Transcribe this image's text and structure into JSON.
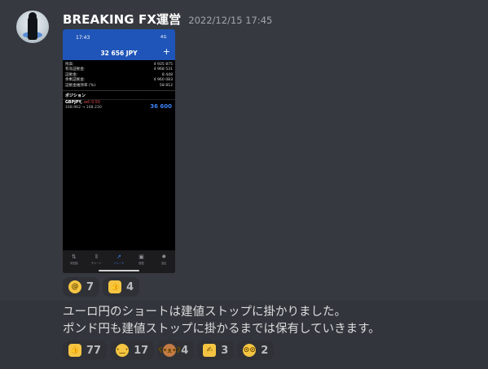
{
  "message": {
    "author": "BREAKING FX運営",
    "timestamp": "2022/12/15 17:45",
    "lines": [
      "ユーロ円のショートは建値ストップに掛かりました。",
      "ポンド円も建値ストップに掛かるまでは保有していきます。"
    ]
  },
  "attachment": {
    "status_time": "17:43",
    "status_right": "4G",
    "title": "32 656 JPY",
    "plus_label": "+",
    "rows": [
      {
        "label": "残高:",
        "value": "4 935 875"
      },
      {
        "label": "有効証拠金:",
        "value": "4 968 531"
      },
      {
        "label": "証拠金:",
        "value": "8 448"
      },
      {
        "label": "余剰証拠金:",
        "value": "4 960 083"
      },
      {
        "label": "証拠金維持率 (%):",
        "value": "58 812"
      }
    ],
    "section_label": "ポジション",
    "position": {
      "symbol": "GBPJPY,",
      "side": "sell 0.50",
      "prices": "168.962 → 168.230",
      "profit": "36 600"
    },
    "nav": [
      {
        "icon": "quotes-icon",
        "label": "気配値"
      },
      {
        "icon": "chart-icon",
        "label": "チャート"
      },
      {
        "icon": "trade-icon",
        "label": "トレード"
      },
      {
        "icon": "history-icon",
        "label": "履歴"
      },
      {
        "icon": "settings-icon",
        "label": "設定"
      }
    ]
  },
  "reactions_top": [
    {
      "emoji": "dizzy-face-emoji",
      "color": "#f5c542",
      "count": "7"
    },
    {
      "emoji": "thumbs-up-emoji",
      "color": "#f5c542",
      "count": "4"
    }
  ],
  "reactions_bottom": [
    {
      "emoji": "thumbs-up-emoji",
      "color": "#f5c542",
      "count": "77"
    },
    {
      "emoji": "saluting-face-emoji",
      "color": "#f5c542",
      "count": "17"
    },
    {
      "emoji": "teddy-bear-emoji",
      "color": "#c47a45",
      "count": "4"
    },
    {
      "emoji": "writing-hand-emoji",
      "color": "#f5c542",
      "count": "3"
    },
    {
      "emoji": "nerd-face-emoji",
      "color": "#f5c542",
      "count": "2"
    }
  ]
}
